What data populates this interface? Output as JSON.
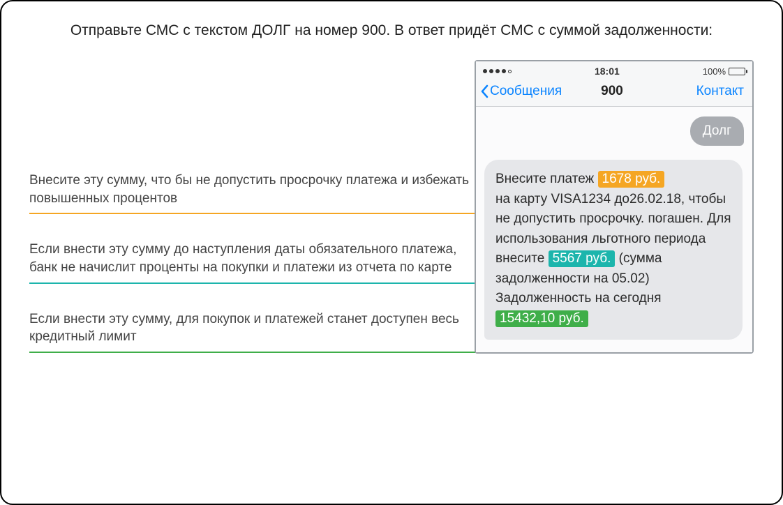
{
  "headline": "Отправьте СМС с текстом ДОЛГ на номер 900. В ответ придёт СМС с суммой задолженности:",
  "notes": {
    "orange": "Внесите эту сумму, что бы не допустить просрочку платежа и избежать повышенных процентов",
    "teal": "Если внести эту сумму до наступления даты обязательного платежа, банк не начислит проценты на покупки и платежи из отчета по карте",
    "green": "Если внести эту сумму, для покупок и платежей станет доступен весь кредитный лимит"
  },
  "phone": {
    "clock": "18:01",
    "battery_pct": "100%",
    "back_label": "Сообщения",
    "title": "900",
    "contact_label": "Контакт",
    "outgoing": "Долг",
    "msg": {
      "p1a": "Внесите платеж ",
      "h1": "1678 руб.",
      "p1b": "на карту VISA1234 до26.02.18, чтобы не допустить просрочку. погашен. Для использования льготного периода",
      "p2a": "внесите ",
      "h2": "5567 руб.",
      "p2b": " (сумма задолженности на 05.02) Задолженность на сегодня",
      "h3": "15432,10 руб."
    }
  },
  "colors": {
    "orange": "#f5a623",
    "teal": "#1cb5ac",
    "green": "#3fae49",
    "ios_blue": "#0a84ff"
  }
}
